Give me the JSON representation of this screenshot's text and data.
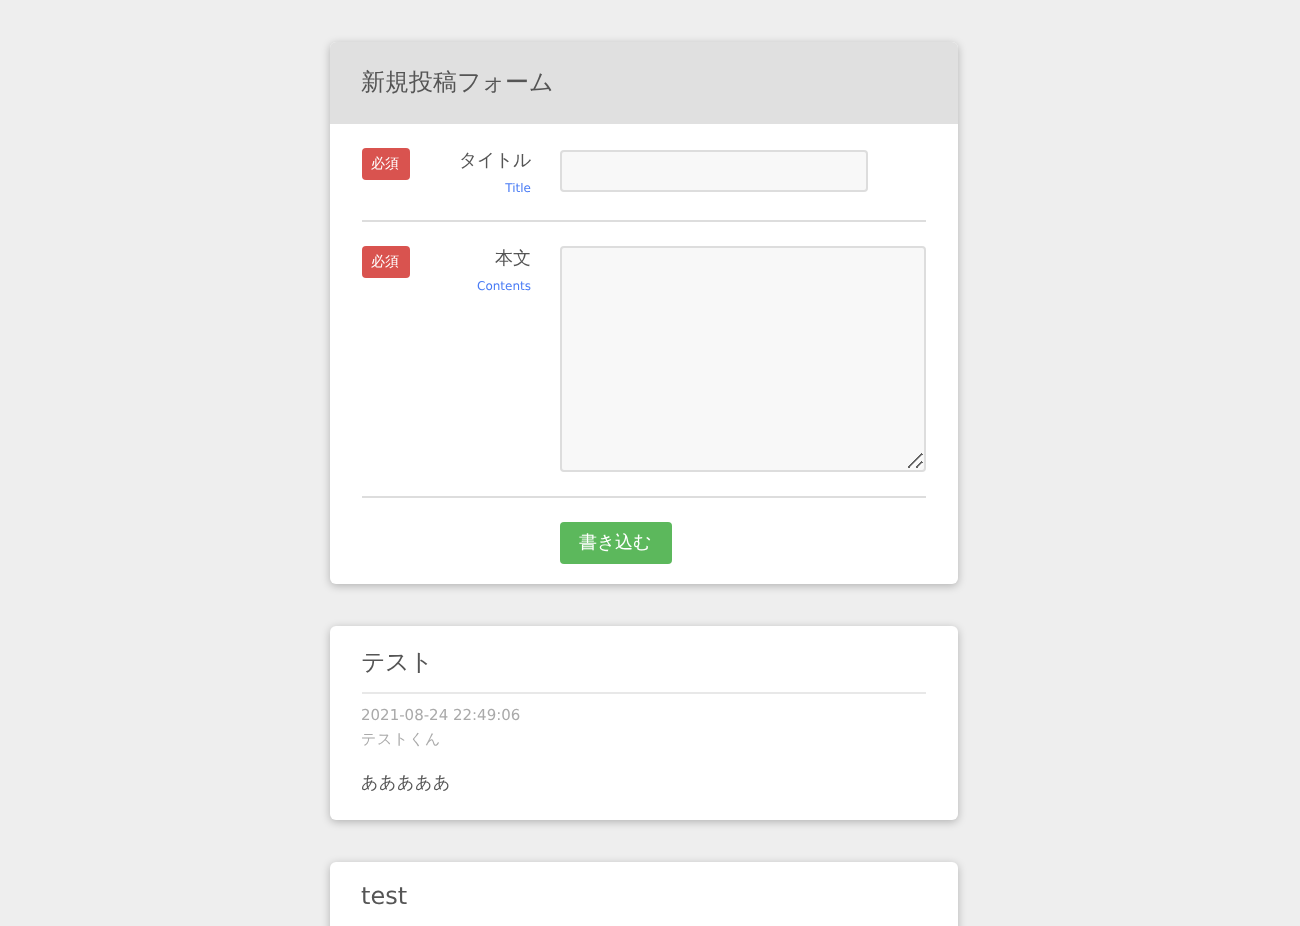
{
  "form": {
    "heading": "新規投稿フォーム",
    "fields": [
      {
        "kind": "input",
        "badge": "必須",
        "label": "タイトル",
        "sublabel": "Title"
      },
      {
        "kind": "textarea",
        "badge": "必須",
        "label": "本文",
        "sublabel": "Contents"
      }
    ],
    "submit": "書き込む"
  },
  "posts": [
    {
      "title": "テスト",
      "date": "2021-08-24 22:49:06",
      "author": "テストくん",
      "body": "あああああ"
    },
    {
      "title": "test"
    }
  ]
}
